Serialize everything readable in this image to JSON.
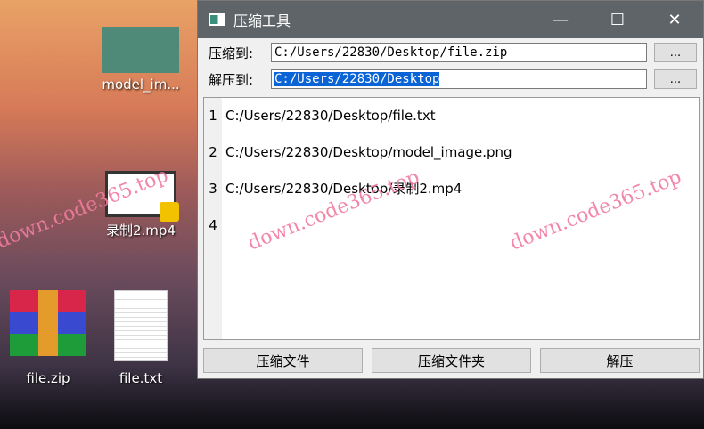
{
  "desktop": {
    "icons": [
      {
        "label": "model_im..."
      },
      {
        "label": "录制2.mp4"
      },
      {
        "label": "file.zip"
      },
      {
        "label": "file.txt"
      }
    ]
  },
  "window": {
    "title": "压缩工具",
    "minimize": "—",
    "maximize": "☐",
    "close": "✕"
  },
  "compress_to": {
    "label": "压缩到:",
    "value": "C:/Users/22830/Desktop/file.zip",
    "browse": "..."
  },
  "extract_to": {
    "label": "解压到:",
    "value": "C:/Users/22830/Desktop",
    "browse": "..."
  },
  "editor": {
    "line_numbers": [
      "1",
      "2",
      "3",
      "4"
    ],
    "lines": [
      "C:/Users/22830/Desktop/file.txt",
      "C:/Users/22830/Desktop/model_image.png",
      "C:/Users/22830/Desktop/录制2.mp4",
      ""
    ]
  },
  "buttons": {
    "compress_file": "压缩文件",
    "compress_folder": "压缩文件夹",
    "extract": "解压"
  },
  "watermark": "down.code365.top"
}
